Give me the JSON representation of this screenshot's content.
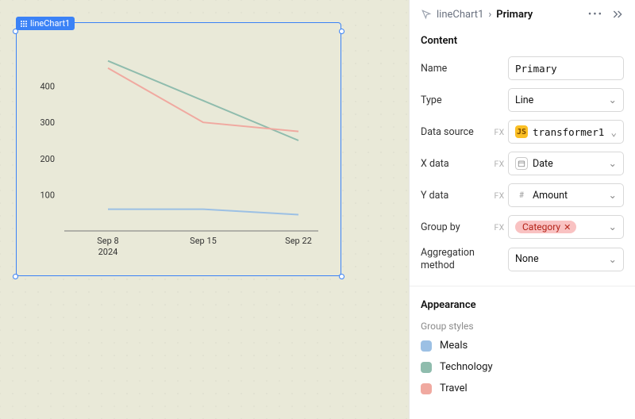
{
  "component_chip": "lineChart1",
  "header": {
    "crumb_root": "lineChart1",
    "crumb_sep": "›",
    "crumb_current": "Primary"
  },
  "content": {
    "section_title": "Content",
    "name_label": "Name",
    "name_value": "Primary",
    "type_label": "Type",
    "type_value": "Line",
    "data_source_label": "Data source",
    "data_source_value": "transformer1",
    "x_label": "X data",
    "x_value": "Date",
    "y_label": "Y data",
    "y_value": "Amount",
    "group_label": "Group by",
    "group_value": "Category",
    "agg_label": "Aggregation method",
    "agg_value": "None",
    "fx": "FX",
    "js": "JS"
  },
  "appearance": {
    "section_title": "Appearance",
    "subtitle": "Group styles",
    "legend": [
      {
        "label": "Meals",
        "color": "#9cc0e4"
      },
      {
        "label": "Technology",
        "color": "#8fbcad"
      },
      {
        "label": "Travel",
        "color": "#f0a9a0"
      }
    ]
  },
  "chart_data": {
    "type": "line",
    "x": [
      "Sep 8",
      "Sep 15",
      "Sep 22"
    ],
    "x_sub": "2024",
    "ylim": [
      0,
      500
    ],
    "yticks": [
      100,
      200,
      300,
      400
    ],
    "series": [
      {
        "name": "Meals",
        "color": "#9cc0e4",
        "values": [
          60,
          60,
          45
        ]
      },
      {
        "name": "Technology",
        "color": "#8fbcad",
        "values": [
          470,
          360,
          250
        ]
      },
      {
        "name": "Travel",
        "color": "#f0a9a0",
        "values": [
          450,
          300,
          275
        ]
      }
    ]
  }
}
